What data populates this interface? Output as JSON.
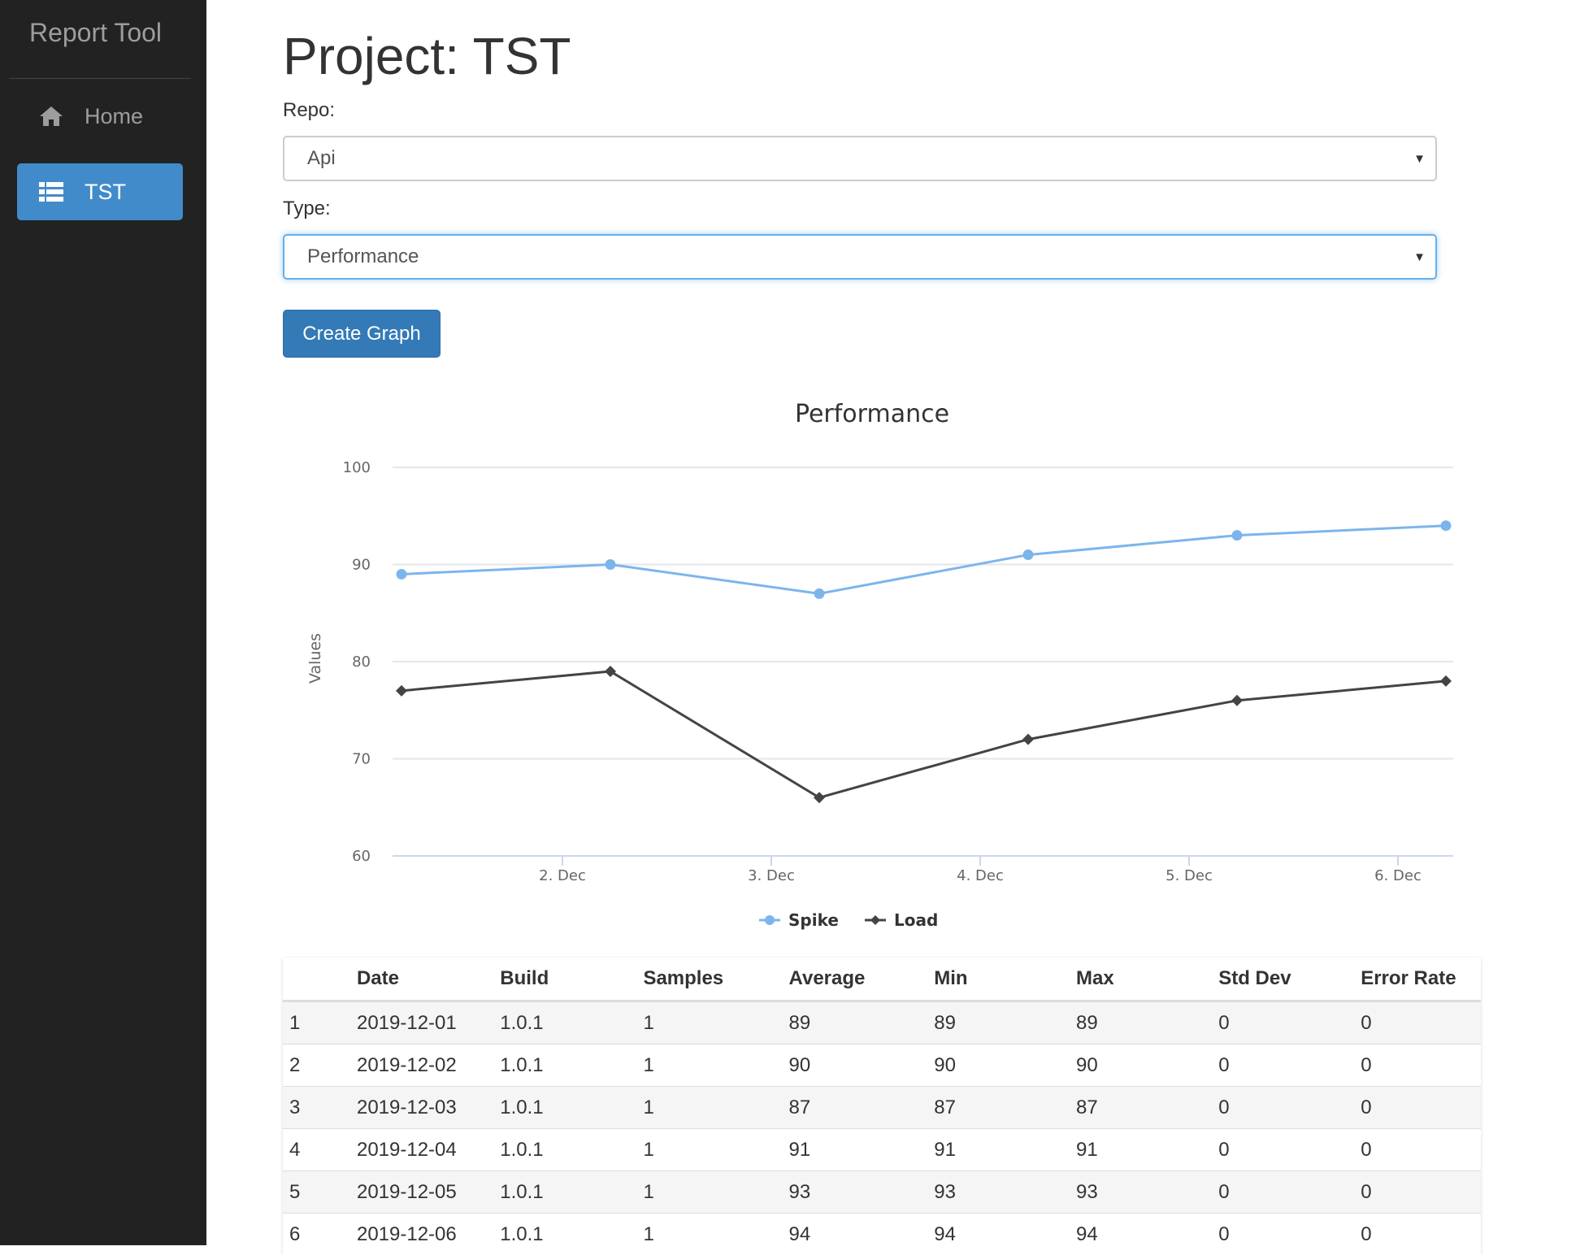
{
  "sidebar": {
    "brand": "Report Tool",
    "items": [
      {
        "label": "Home",
        "icon": "home-icon",
        "active": false
      },
      {
        "label": "TST",
        "icon": "list-icon",
        "active": true
      }
    ],
    "colors": {
      "background": "#222222",
      "active": "#428bca",
      "text": "#9d9d9d"
    }
  },
  "main": {
    "title": "Project: TST",
    "repo": {
      "label": "Repo:",
      "value": "Api"
    },
    "type": {
      "label": "Type:",
      "value": "Performance"
    },
    "create_button": "Create Graph"
  },
  "chart_data": {
    "type": "line",
    "title": "Performance",
    "ylabel": "Values",
    "xlabel": "",
    "x": [
      "2019-12-01",
      "2019-12-02",
      "2019-12-03",
      "2019-12-04",
      "2019-12-05",
      "2019-12-06"
    ],
    "x_ticks": [
      "2. Dec",
      "3. Dec",
      "4. Dec",
      "5. Dec",
      "6. Dec"
    ],
    "ylim": [
      60,
      100
    ],
    "y_ticks": [
      "100",
      "90",
      "80",
      "70",
      "60"
    ],
    "grid": true,
    "legend": "bottom-center",
    "series": [
      {
        "name": "Spike",
        "color": "#7cb5ec",
        "marker": "circle",
        "values": [
          89,
          90,
          87,
          91,
          93,
          94
        ]
      },
      {
        "name": "Load",
        "color": "#434348",
        "marker": "diamond",
        "values": [
          77,
          79,
          66,
          72,
          76,
          78
        ]
      }
    ]
  },
  "table": {
    "columns": [
      "",
      "Date",
      "Build",
      "Samples",
      "Average",
      "Min",
      "Max",
      "Std Dev",
      "Error Rate"
    ],
    "rows": [
      [
        "1",
        "2019-12-01",
        "1.0.1",
        "1",
        "89",
        "89",
        "89",
        "0",
        "0"
      ],
      [
        "2",
        "2019-12-02",
        "1.0.1",
        "1",
        "90",
        "90",
        "90",
        "0",
        "0"
      ],
      [
        "3",
        "2019-12-03",
        "1.0.1",
        "1",
        "87",
        "87",
        "87",
        "0",
        "0"
      ],
      [
        "4",
        "2019-12-04",
        "1.0.1",
        "1",
        "91",
        "91",
        "91",
        "0",
        "0"
      ],
      [
        "5",
        "2019-12-05",
        "1.0.1",
        "1",
        "93",
        "93",
        "93",
        "0",
        "0"
      ],
      [
        "6",
        "2019-12-06",
        "1.0.1",
        "1",
        "94",
        "94",
        "94",
        "0",
        "0"
      ]
    ]
  }
}
